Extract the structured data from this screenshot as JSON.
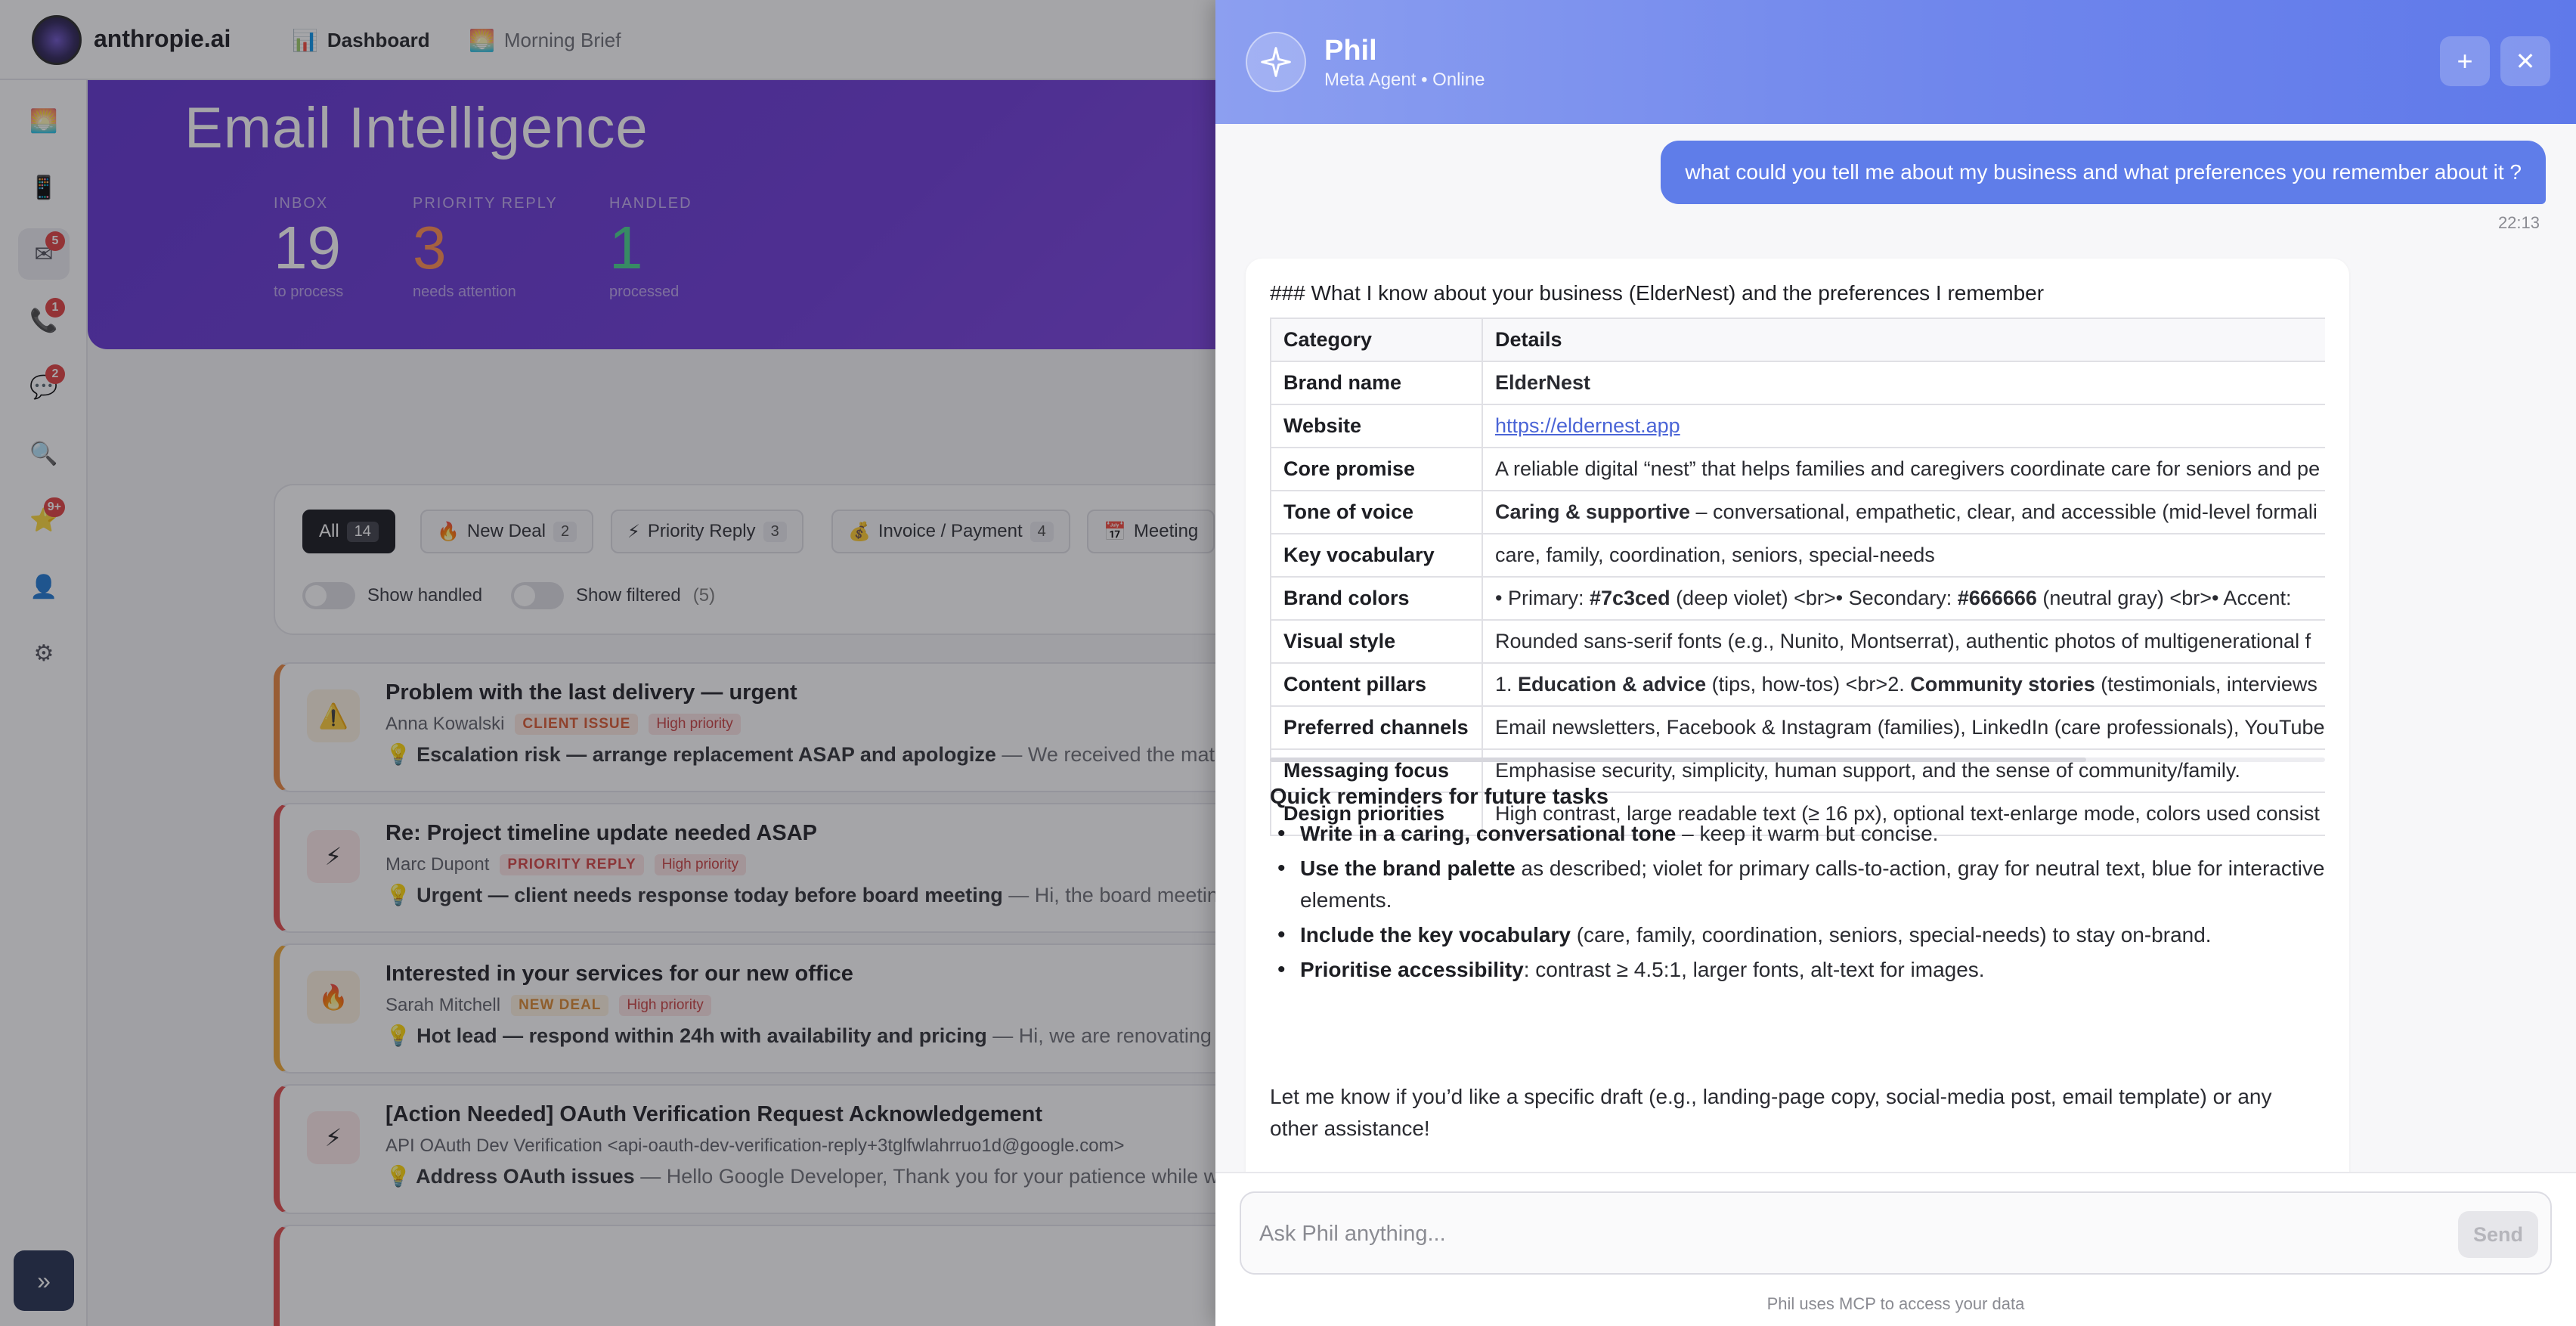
{
  "app": {
    "brand": "anthropie.ai",
    "nav": [
      {
        "icon": "📊",
        "label": "Dashboard"
      },
      {
        "icon": "🌅",
        "label": "Morning Brief"
      }
    ],
    "sidebar_badges": {
      "emails": "5",
      "calls": "1",
      "chats": "2",
      "starred": "9+"
    },
    "hero": {
      "title": "Email Intelligence",
      "stats": [
        {
          "label": "INBOX",
          "value": "19",
          "sub": "to process"
        },
        {
          "label": "PRIORITY REPLY",
          "value": "3",
          "sub": "needs attention"
        },
        {
          "label": "HANDLED",
          "value": "1",
          "sub": "processed"
        }
      ]
    },
    "filters": [
      {
        "icon": "",
        "label": "All",
        "count": "14"
      },
      {
        "icon": "🔥",
        "label": "New Deal",
        "count": "2"
      },
      {
        "icon": "⚡",
        "label": "Priority Reply",
        "count": "3"
      },
      {
        "icon": "💰",
        "label": "Invoice / Payment",
        "count": "4"
      },
      {
        "icon": "📅",
        "label": "Meeting",
        "count": ""
      }
    ],
    "toggles": {
      "show_handled": "Show handled",
      "show_filtered": "Show filtered",
      "filtered_count": "(5)"
    },
    "emails": [
      {
        "icon": "⚠️",
        "subject": "Problem with the last delivery — urgent",
        "sender": "Anna Kowalski",
        "tag": "CLIENT ISSUE",
        "priority": "High priority",
        "insight_bold": "💡 Escalation risk — arrange replacement ASAP and apologize",
        "insight_rest": " — We received the material"
      },
      {
        "icon": "⚡",
        "subject": "Re: Project timeline update needed ASAP",
        "sender": "Marc Dupont",
        "tag": "PRIORITY REPLY",
        "priority": "High priority",
        "insight_bold": "💡 Urgent — client needs response today before board meeting",
        "insight_rest": " — Hi, the board meeting is"
      },
      {
        "icon": "🔥",
        "subject": "Interested in your services for our new office",
        "sender": "Sarah Mitchell",
        "tag": "NEW DEAL",
        "priority": "High priority",
        "insight_bold": "💡 Hot lead — respond within 24h with availability and pricing",
        "insight_rest": " — Hi, we are renovating our"
      },
      {
        "icon": "⚡",
        "subject": "[Action Needed] OAuth Verification Request Acknowledgement",
        "sender": "API OAuth Dev Verification <api-oauth-dev-verification-reply+3tglfwlahrruo1d@google.com>",
        "tag": "",
        "priority": "",
        "insight_bold": "💡 Address OAuth issues",
        "insight_rest": " — Hello Google Developer, Thank you for your patience while we"
      }
    ],
    "colors": {
      "hero": "#6a35d8",
      "accent_orange": "#ff8a4c",
      "accent_green": "#43d38a"
    }
  },
  "chat": {
    "agent_name": "Phil",
    "agent_status": "Meta Agent • Online",
    "user_message": "what could you tell me about my business and what preferences you remember about it ?",
    "user_time": "22:13",
    "reply_heading": "### What I know about your business (ElderNest) and the preferences I remember",
    "table_headers": [
      "Category",
      "Details"
    ],
    "table_rows": [
      {
        "k": "Brand name",
        "v": "ElderNest"
      },
      {
        "k": "Website",
        "v": "https://eldernest.app"
      },
      {
        "k": "Core promise",
        "v": "A reliable digital “nest” that helps families and caregivers coordinate care for seniors and pe"
      },
      {
        "k": "Tone of voice",
        "v_bold": "Caring & supportive",
        "v": " – conversational, empathetic, clear, and accessible (mid-level formali"
      },
      {
        "k": "Key vocabulary",
        "v": "care, family, coordination, seniors, special-needs"
      },
      {
        "k": "Brand colors",
        "v1": "• Primary: ",
        "b1": "#7c3ced",
        "v2": " (deep violet) <br>• Secondary: ",
        "b2": "#666666",
        "v3": " (neutral gray) <br>• Accent:"
      },
      {
        "k": "Visual style",
        "v": "Rounded sans-serif fonts (e.g., Nunito, Montserrat), authentic photos of multigenerational f"
      },
      {
        "k": "Content pillars",
        "v1": "1. ",
        "b1": "Education & advice",
        "v2": " (tips, how-tos) <br>2. ",
        "b2": "Community stories",
        "v3": " (testimonials, interviews"
      },
      {
        "k": "Preferred channels",
        "v": "Email newsletters, Facebook & Instagram (families), LinkedIn (care professionals), YouTube"
      },
      {
        "k": "Messaging focus",
        "v": "Emphasise security, simplicity, human support, and the sense of community/family."
      },
      {
        "k": "Design priorities",
        "v": "High contrast, large readable text (≥ 16 px), optional text-enlarge mode, colors used consist"
      }
    ],
    "reminders_title": "Quick reminders for future tasks",
    "reminders": [
      {
        "bold": "Write in a caring, conversational tone",
        "rest": " – keep it warm but concise."
      },
      {
        "bold": "Use the brand palette",
        "rest": " as described; violet for primary calls-to-action, gray for neutral text, blue for interactive elements."
      },
      {
        "bold": "Include the key vocabulary",
        "rest": " (care, family, coordination, seniors, special-needs) to stay on-brand."
      },
      {
        "bold": "Prioritise accessibility",
        "rest": ": contrast ≥ 4.5:1, larger fonts, alt-text for images."
      }
    ],
    "closing": "Let me know if you’d like a specific draft (e.g., landing-page copy, social-media post, email template) or any other assistance!",
    "input_placeholder": "Ask Phil anything...",
    "send_label": "Send",
    "footnote": "Phil uses MCP to access your data",
    "colors": {
      "header": "#6f86ec",
      "user_bubble": "#5f7de9"
    }
  }
}
